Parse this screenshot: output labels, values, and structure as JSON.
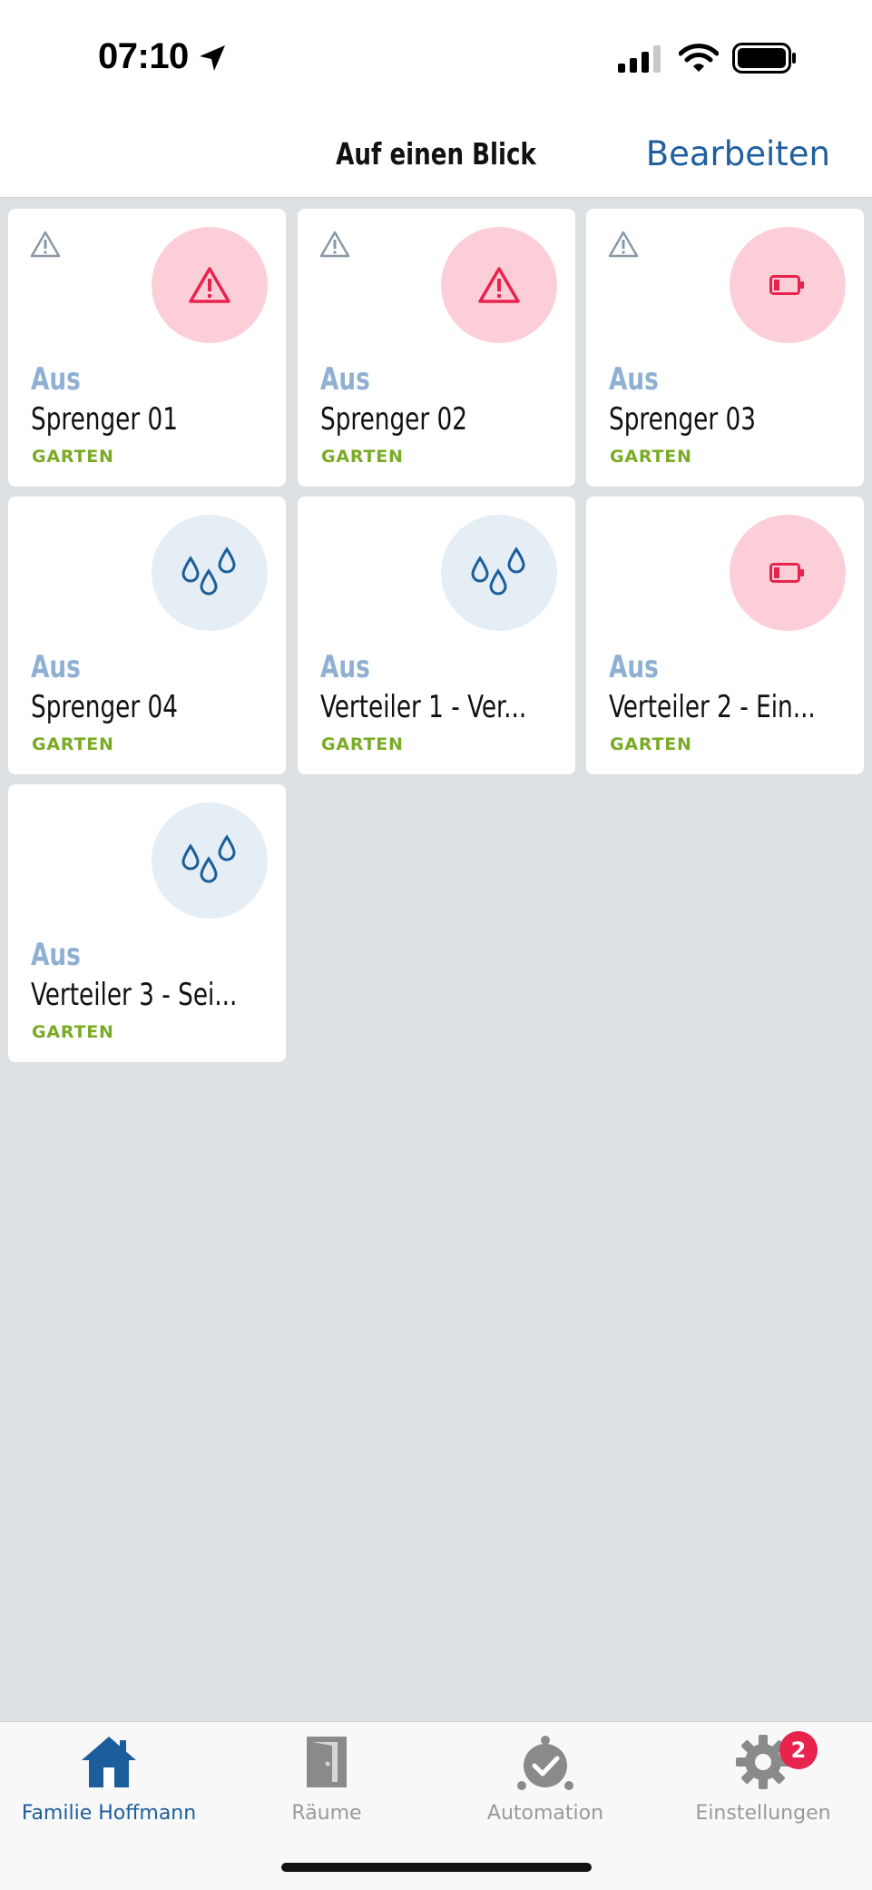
{
  "status_bar": {
    "time": "07:10"
  },
  "header": {
    "title": "Auf einen Blick",
    "edit_label": "Bearbeiten"
  },
  "colors": {
    "accent": "#1f5f9e",
    "state_text": "#8fb0d2",
    "room_text": "#7aab25",
    "alert_circle": "#fccfd8",
    "ok_circle": "#e5edf5",
    "badge": "#e8234e"
  },
  "devices": [
    {
      "state": "Aus",
      "name": "Sprenger 01",
      "room": "GARTEN",
      "icon": "warning-icon",
      "status_icon": "warning-small-icon"
    },
    {
      "state": "Aus",
      "name": "Sprenger 02",
      "room": "GARTEN",
      "icon": "warning-icon",
      "status_icon": "warning-small-icon"
    },
    {
      "state": "Aus",
      "name": "Sprenger 03",
      "room": "GARTEN",
      "icon": "low-battery-icon",
      "status_icon": "warning-small-icon"
    },
    {
      "state": "Aus",
      "name": "Sprenger 04",
      "room": "GARTEN",
      "icon": "water-drops-icon"
    },
    {
      "state": "Aus",
      "name": "Verteiler 1 - Ver...",
      "room": "GARTEN",
      "icon": "water-drops-icon"
    },
    {
      "state": "Aus",
      "name": "Verteiler 2 - Ein...",
      "room": "GARTEN",
      "icon": "low-battery-icon"
    },
    {
      "state": "Aus",
      "name": "Verteiler 3 - Sei...",
      "room": "GARTEN",
      "icon": "water-drops-icon"
    }
  ],
  "tabs": [
    {
      "label": "Familie Hoffmann",
      "icon": "home-icon",
      "active": true
    },
    {
      "label": "Räume",
      "icon": "door-icon"
    },
    {
      "label": "Automation",
      "icon": "alarm-clock-icon"
    },
    {
      "label": "Einstellungen",
      "icon": "gear-icon",
      "badge": "2"
    }
  ]
}
